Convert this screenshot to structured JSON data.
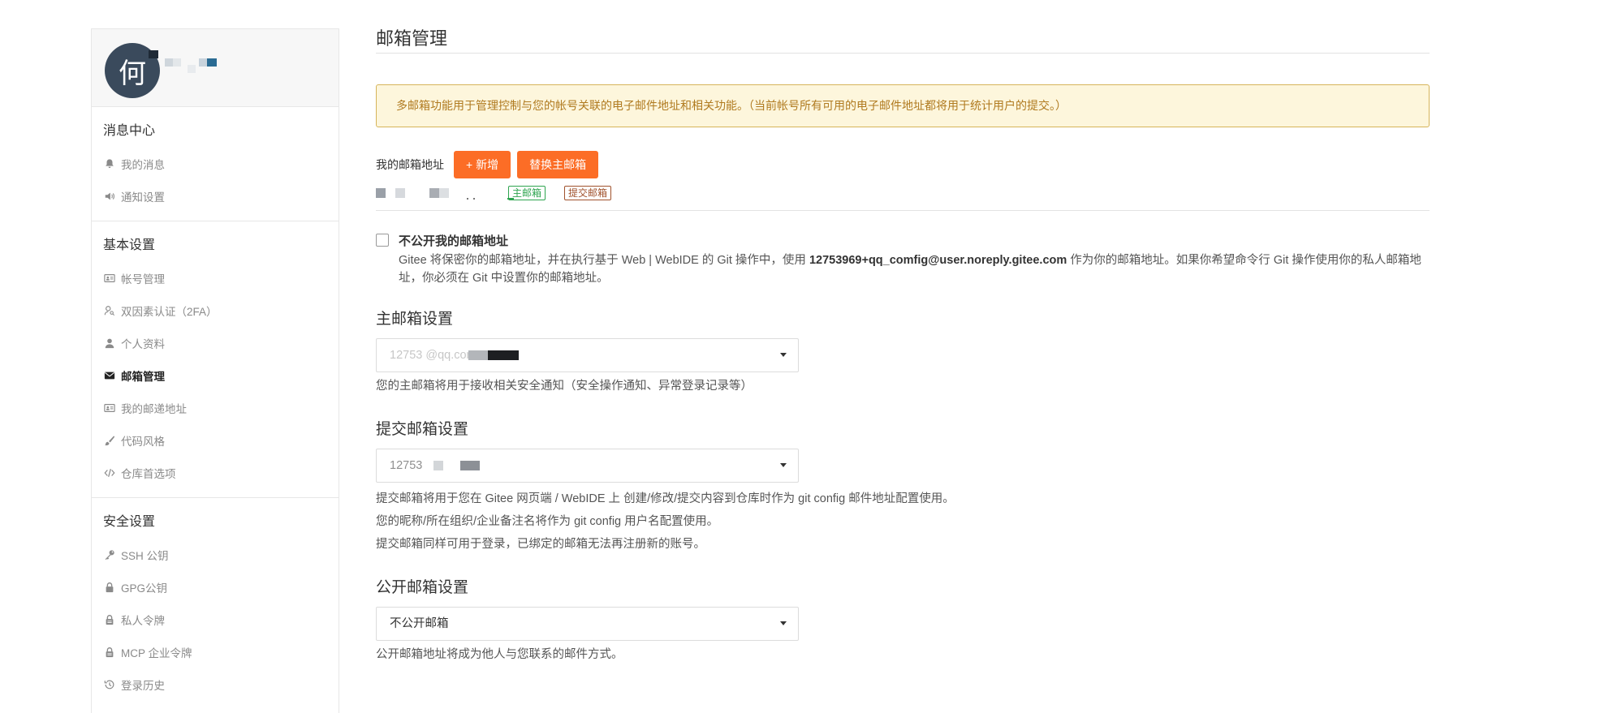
{
  "sidebar": {
    "avatar_text": "何",
    "sections": [
      {
        "title": "消息中心",
        "items": [
          {
            "label": "我的消息",
            "icon": "bell-icon"
          },
          {
            "label": "通知设置",
            "icon": "speaker-icon"
          }
        ]
      },
      {
        "title": "基本设置",
        "items": [
          {
            "label": "帐号管理",
            "icon": "id-card-icon"
          },
          {
            "label": "双因素认证（2FA）",
            "icon": "user-key-icon"
          },
          {
            "label": "个人资料",
            "icon": "user-icon"
          },
          {
            "label": "邮箱管理",
            "icon": "envelope-icon",
            "active": true
          },
          {
            "label": "我的邮递地址",
            "icon": "address-card-icon"
          },
          {
            "label": "代码风格",
            "icon": "brush-icon"
          },
          {
            "label": "仓库首选项",
            "icon": "code-icon"
          }
        ]
      },
      {
        "title": "安全设置",
        "items": [
          {
            "label": "SSH 公钥",
            "icon": "key-icon"
          },
          {
            "label": "GPG公钥",
            "icon": "lock-icon"
          },
          {
            "label": "私人令牌",
            "icon": "token-icon"
          },
          {
            "label": "MCP 企业令牌",
            "icon": "token-icon"
          },
          {
            "label": "登录历史",
            "icon": "history-icon"
          }
        ]
      }
    ]
  },
  "main": {
    "title": "邮箱管理",
    "notice": "多邮箱功能用于管理控制与您的帐号关联的电子邮件地址和相关功能。（当前帐号所有可用的电子邮件地址都将用于统计用户的提交。）",
    "email_label": "我的邮箱地址",
    "add_button": "+ 新增",
    "replace_button": "替换主邮箱",
    "tag_primary": "主邮箱",
    "tag_commit": "提交邮箱",
    "privacy": {
      "title": "不公开我的邮箱地址",
      "desc_before": "Gitee 将保密你的邮箱地址，并在执行基于 Web | WebIDE 的 Git 操作中，使用 ",
      "noreply": "12753969+qq_comfig@user.noreply.gitee.com",
      "desc_after": " 作为你的邮箱地址。如果你希望命令行 Git 操作使用你的私人邮箱地址，你必须在 Git 中设置你的邮箱地址。"
    },
    "primary_setting": {
      "title": "主邮箱设置",
      "value": "12753 @qq.com",
      "hint": "您的主邮箱将用于接收相关安全通知（安全操作通知、异常登录记录等）"
    },
    "commit_setting": {
      "title": "提交邮箱设置",
      "value": "12753",
      "hints": [
        "提交邮箱将用于您在 Gitee 网页端 / WebIDE 上 创建/修改/提交内容到仓库时作为 git config 邮件地址配置使用。",
        "您的昵称/所在组织/企业备注名将作为 git config 用户名配置使用。",
        "提交邮箱同样可用于登录，已绑定的邮箱无法再注册新的账号。"
      ]
    },
    "public_setting": {
      "title": "公开邮箱设置",
      "value": "不公开邮箱",
      "hint": "公开邮箱地址将成为他人与您联系的邮件方式。"
    }
  },
  "colors": {
    "accent": "#fc6d26",
    "notice_bg": "#fdf6dc",
    "notice_text": "#b07a1f",
    "tag_primary": "#2ea44f",
    "tag_commit": "#a0522d"
  }
}
